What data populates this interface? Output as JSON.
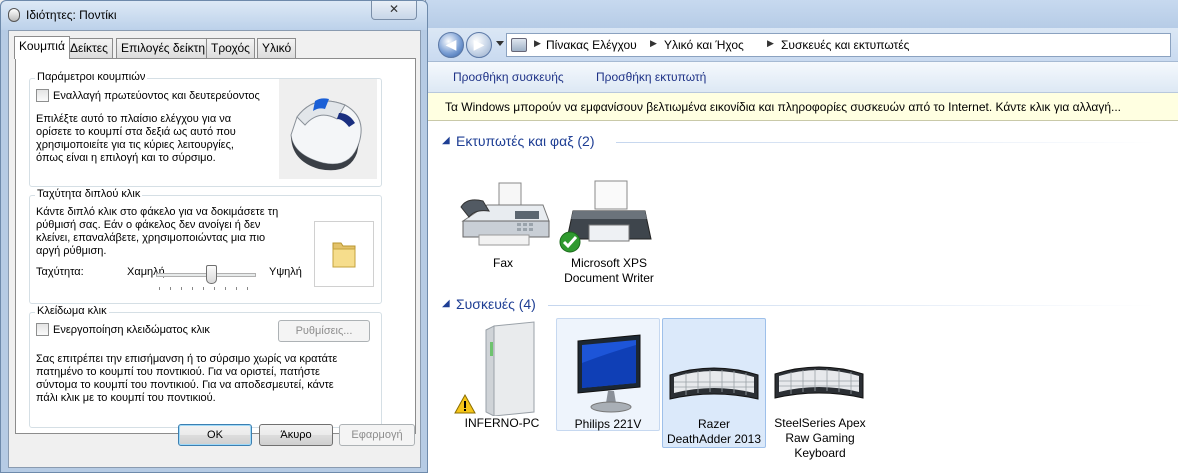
{
  "dialog": {
    "title": "Ιδιότητες: Ποντίκι",
    "close_label": "✕",
    "tabs": [
      {
        "label": "Κουμπιά",
        "active": true
      },
      {
        "label": "Δείκτες",
        "active": false
      },
      {
        "label": "Επιλογές δείκτη",
        "active": false
      },
      {
        "label": "Τροχός",
        "active": false
      },
      {
        "label": "Υλικό",
        "active": false
      }
    ],
    "button_config": {
      "legend": "Παράμετροι κουμπιών",
      "checkbox_label": "Εναλλαγή πρωτεύοντος και δευτερεύοντος",
      "checked": false,
      "description": [
        "Επιλέξτε αυτό το πλαίσιο ελέγχου για να",
        "ορίσετε το κουμπί στα δεξιά ως αυτό που",
        "χρησιμοποιείτε για τις κύριες λειτουργίες,",
        "όπως είναι η επιλογή και το σύρσιμο."
      ]
    },
    "double_click": {
      "legend": "Ταχύτητα διπλού κλικ",
      "description": [
        "Κάντε διπλό κλικ στο φάκελο για να δοκιμάσετε τη",
        "ρύθμισή σας.  Εάν ο φάκελος δεν ανοίγει ή δεν",
        "κλείνει, επαναλάβετε, χρησιμοποιώντας μια πιο",
        "αργή ρύθμιση."
      ],
      "speed_label": "Ταχύτητα:",
      "slow_label": "Χαμηλή",
      "fast_label": "Υψηλή",
      "speed_fraction": 0.6
    },
    "click_lock": {
      "legend": "Κλείδωμα κλικ",
      "checkbox_label": "Ενεργοποίηση κλειδώματος κλικ",
      "checked": false,
      "settings_label": "Ρυθμίσεις...",
      "description": [
        "Σας επιτρέπει την επισήμανση ή το σύρσιμο χωρίς να κρατάτε",
        "πατημένο το κουμπί του ποντικιού.  Για να οριστεί, πατήστε",
        "σύντομα το κουμπί του ποντικιού.  Για να αποδεσμευτεί, κάντε",
        "πάλι κλικ με το κουμπί του ποντικιού."
      ]
    },
    "ok_label": "ΟΚ",
    "cancel_label": "Άκυρο",
    "apply_label": "Εφαρμογή"
  },
  "explorer": {
    "breadcrumb": [
      "Πίνακας Ελέγχου",
      "Υλικό και Ήχος",
      "Συσκευές και εκτυπωτές"
    ],
    "commands": [
      "Προσθήκη συσκευής",
      "Προσθήκη εκτυπωτή"
    ],
    "infobar": "Τα Windows μπορούν να εμφανίσουν βελτιωμένα εικονίδια και πληροφορίες συσκευών από το Internet. Κάντε κλικ για αλλαγή...",
    "groups": [
      {
        "title": "Εκτυπωτές και φαξ (2)",
        "items": [
          {
            "name": "Fax",
            "lines": [
              "Fax"
            ],
            "icon": "fax-icon"
          },
          {
            "name": "Microsoft XPS Document Writer",
            "lines": [
              "Microsoft XPS",
              "Document Writer"
            ],
            "icon": "printer-icon",
            "badge": "default-check-icon"
          }
        ]
      },
      {
        "title": "Συσκευές (4)",
        "items": [
          {
            "name": "INFERNO-PC",
            "lines": [
              "INFERNO-PC"
            ],
            "icon": "computer-tower-icon",
            "badge": "warning-icon"
          },
          {
            "name": "Philips 221V",
            "lines": [
              "Philips 221V"
            ],
            "icon": "monitor-icon"
          },
          {
            "name": "Razer DeathAdder 2013",
            "lines": [
              "Razer",
              "DeathAdder 2013"
            ],
            "icon": "keyboard-icon"
          },
          {
            "name": "SteelSeries Apex Raw Gaming Keyboard",
            "lines": [
              "SteelSeries Apex",
              "Raw Gaming",
              "Keyboard"
            ],
            "icon": "keyboard-icon"
          }
        ]
      }
    ]
  },
  "colors": {
    "link_blue": "#1e3287",
    "group_blue": "#1e3e94",
    "infobar_bg": "#ffffe1",
    "selection_bg": "#dbe9fa"
  }
}
